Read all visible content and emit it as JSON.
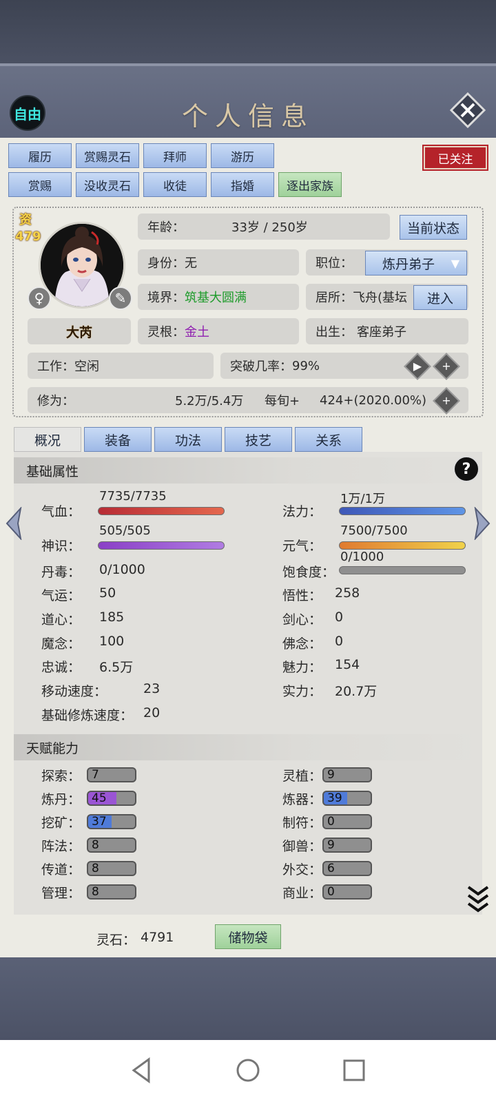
{
  "header": {
    "title": "个人信息",
    "free_label": "自由",
    "close_icon": "close-icon"
  },
  "actions_row1": [
    "履历",
    "赏赐灵石",
    "拜师",
    "游历"
  ],
  "actions_row2": [
    "赏赐",
    "没收灵石",
    "收徒",
    "指婚",
    "逐出家族"
  ],
  "follow_label": "已关注",
  "profile": {
    "qualification_label": "资",
    "qualification_value": "479",
    "name": "大芮",
    "gender_icon": "female-icon",
    "edit_icon": "quill-icon",
    "age_label": "年龄：",
    "age_value": "33岁 / 250岁",
    "status_button": "当前状态",
    "identity_label": "身份：",
    "identity_value": "无",
    "position_label": "职位：",
    "position_value": "炼丹弟子",
    "realm_label": "境界：",
    "realm_value": "筑基大圆满",
    "residence_label": "居所：",
    "residence_value": "飞舟(基坛",
    "enter_button": "进入",
    "root_label": "灵根：",
    "root_value": "金土",
    "birth_label": "出生：",
    "birth_value": "客座弟子",
    "work_label": "工作：",
    "work_value": "空闲",
    "breakthrough_label": "突破几率：",
    "breakthrough_value": "99%",
    "cultivation_label": "修为：",
    "cultivation_value": "5.2万/5.4万",
    "per_turn_label": "每旬+",
    "per_turn_value": "424+(2020.00%)"
  },
  "tabs": [
    "概况",
    "装备",
    "功法",
    "技艺",
    "关系"
  ],
  "basic": {
    "title": "基础属性",
    "hp_label": "气血：",
    "hp_value": "7735/7735",
    "mana_label": "法力：",
    "mana_value": "1万/1万",
    "sense_label": "神识：",
    "sense_value": "505/505",
    "vitality_label": "元气：",
    "vitality_value": "7500/7500",
    "satiety_label": "饱食度：",
    "satiety_value": "0/1000",
    "left": [
      {
        "label": "丹毒：",
        "value": "0/1000"
      },
      {
        "label": "气运：",
        "value": "50"
      },
      {
        "label": "道心：",
        "value": "185"
      },
      {
        "label": "魔念：",
        "value": "100"
      },
      {
        "label": "忠诚：",
        "value": "6.5万"
      },
      {
        "label": "移动速度：",
        "value": "23"
      },
      {
        "label": "基础修炼速度：",
        "value": "20"
      }
    ],
    "right": [
      {
        "label": "悟性：",
        "value": "258"
      },
      {
        "label": "剑心：",
        "value": "0"
      },
      {
        "label": "佛念：",
        "value": "0"
      },
      {
        "label": "魅力：",
        "value": "154"
      },
      {
        "label": "实力：",
        "value": "20.7万"
      }
    ]
  },
  "talent": {
    "title": "天赋能力",
    "left": [
      {
        "label": "探索：",
        "value": "7"
      },
      {
        "label": "炼丹：",
        "value": "45"
      },
      {
        "label": "挖矿：",
        "value": "37"
      },
      {
        "label": "阵法：",
        "value": "8"
      },
      {
        "label": "传道：",
        "value": "8"
      },
      {
        "label": "管理：",
        "value": "8"
      }
    ],
    "right": [
      {
        "label": "灵植：",
        "value": "9"
      },
      {
        "label": "炼器：",
        "value": "39"
      },
      {
        "label": "制符：",
        "value": "0"
      },
      {
        "label": "御兽：",
        "value": "9"
      },
      {
        "label": "外交：",
        "value": "6"
      },
      {
        "label": "商业：",
        "value": "0"
      }
    ]
  },
  "footer": {
    "spirit_stone_label": "灵石：",
    "spirit_stone_value": "4791",
    "bag_button": "储物袋"
  },
  "colors": {
    "hp": "#d9413f",
    "mana": "#4d77d6",
    "sense": "#9b52d6",
    "vitality": "#e8a23a",
    "accent_green": "#1e9b2b"
  }
}
